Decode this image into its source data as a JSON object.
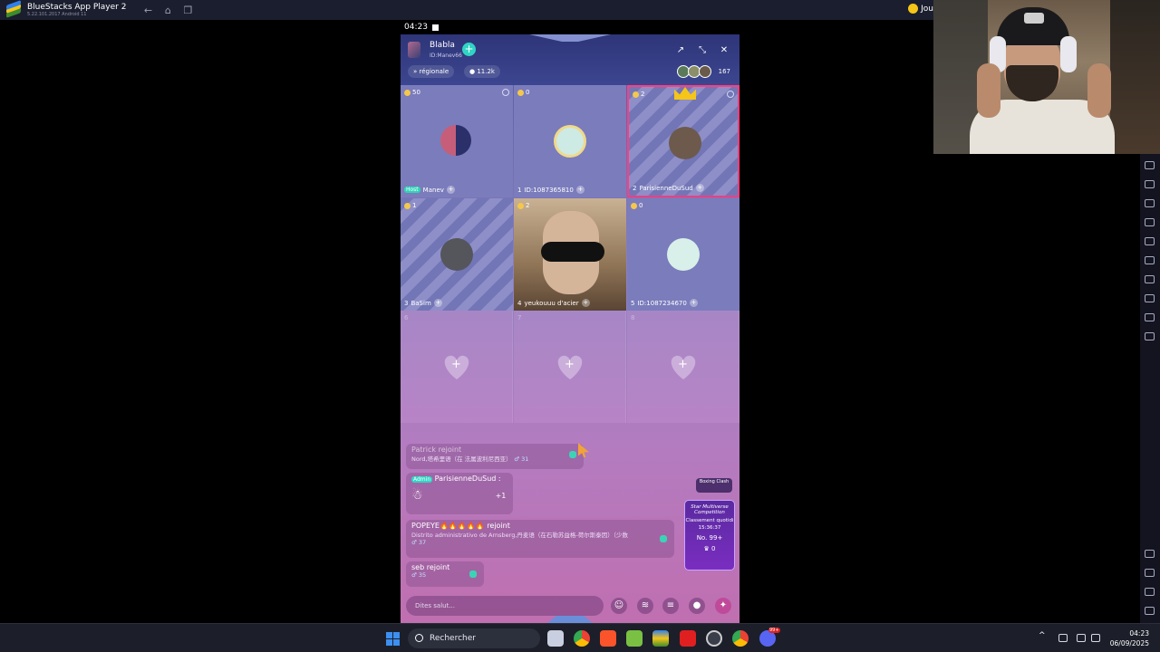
{
  "bluestacks": {
    "title": "BlueStacks App Player 2",
    "version": "5.22.101.2017  Android 11",
    "account_label": "Jou"
  },
  "phone": {
    "status_time": "04:23",
    "room": {
      "name": "Blabla",
      "id": "ID:Manev66",
      "tag_region": "» régionale",
      "heat": "11.2k",
      "viewer_count": "167"
    },
    "seats": [
      {
        "coins": "50",
        "index": "Host",
        "name": "Manev"
      },
      {
        "coins": "0",
        "index": "1",
        "name": "ID:1087365810"
      },
      {
        "coins": "2",
        "index": "2",
        "name": "ParisienneDuSud"
      },
      {
        "coins": "1",
        "index": "3",
        "name": "BaSim"
      },
      {
        "coins": "2",
        "index": "4",
        "name": "yeukouuu d'acier"
      },
      {
        "coins": "0",
        "index": "5",
        "name": "ID:1087234670"
      },
      {
        "index": "6"
      },
      {
        "index": "7"
      },
      {
        "index": "8"
      }
    ],
    "chat": [
      {
        "user": "Patrick rejoint",
        "location": "Nord,塔希里语（在 法属波利尼西亚）",
        "count": "31"
      },
      {
        "tag": "Admin",
        "user": "ParisienneDuSud",
        "extra": "+1"
      },
      {
        "user": "POPEYE🔥🔥🔥🔥🔥 rejoint",
        "location": "Distrito administrativo de Arnsberg,丹麦语（在石勒苏益格-荷尔斯泰因）（少数",
        "count": "37"
      },
      {
        "user": "seb rejoint",
        "count": "35"
      }
    ],
    "boxing_label": "Boxing Clash",
    "ranking": {
      "title": "Star Multiverse Competition",
      "subtitle": "Classement quotidi",
      "timer": "15:36:37",
      "rank": "No. 99+",
      "score": "0"
    },
    "input_placeholder": "Dites salut..."
  },
  "taskbar": {
    "search_label": "Rechercher",
    "time": "04:23",
    "date": "06/09/2025",
    "badge": "99+"
  }
}
